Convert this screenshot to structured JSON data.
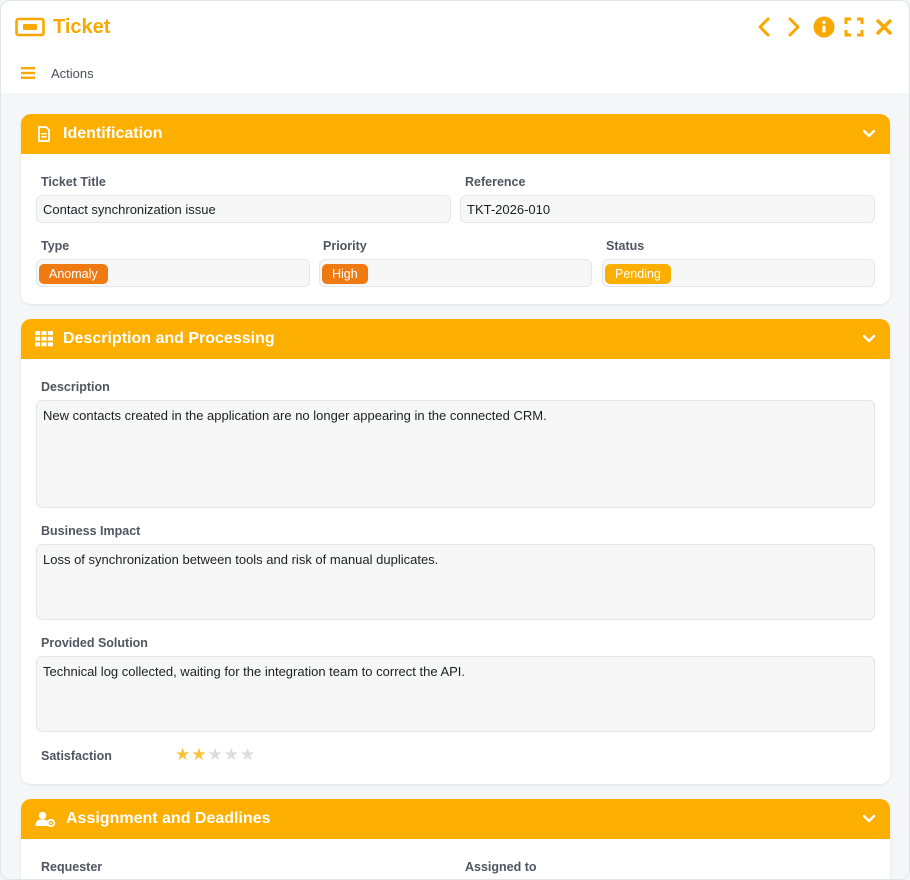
{
  "window": {
    "title": "Ticket",
    "accent_color": "#fdaf00",
    "controls": [
      {
        "name": "previous-icon"
      },
      {
        "name": "next-icon"
      },
      {
        "name": "info-icon"
      },
      {
        "name": "maximize-icon"
      },
      {
        "name": "close-icon"
      }
    ]
  },
  "toolbar": {
    "actions_label": "Actions"
  },
  "identification": {
    "title": "Identification",
    "ticket_title_label": "Ticket Title",
    "ticket_title_value": "Contact synchronization issue",
    "reference_label": "Reference",
    "reference_value": "TKT-2026-010",
    "type_label": "Type",
    "type_value": "Anomaly",
    "type_color": "#f07a12",
    "priority_label": "Priority",
    "priority_value": "High",
    "priority_color": "#f07a12",
    "status_label": "Status",
    "status_value": "Pending",
    "status_color": "#fdaf00"
  },
  "description": {
    "title": "Description and Processing",
    "description_label": "Description",
    "description_value": "New contacts created in the application are no longer appearing in the connected CRM.",
    "impact_label": "Business Impact",
    "impact_value": "Loss of synchronization between tools and risk of manual duplicates.",
    "solution_label": "Provided Solution",
    "solution_value": "Technical log collected, waiting for the integration team to correct the API.",
    "satisfaction_label": "Satisfaction",
    "satisfaction_rating": 2,
    "satisfaction_max": 5,
    "star_filled_color": "#f8c43a",
    "star_empty_color": "#dcdde0"
  },
  "assignment": {
    "title": "Assignment and Deadlines",
    "requester_label": "Requester",
    "assigned_label": "Assigned to"
  }
}
